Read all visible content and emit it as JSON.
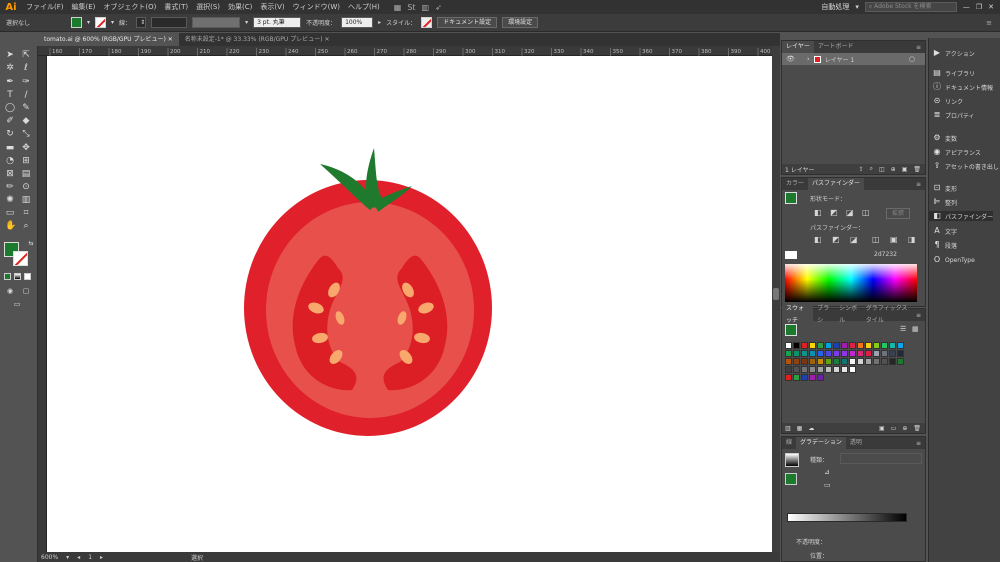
{
  "app": {
    "logo": "Ai"
  },
  "menubar": {
    "items": [
      "ファイル(F)",
      "編集(E)",
      "オブジェクト(O)",
      "書式(T)",
      "選択(S)",
      "効果(C)",
      "表示(V)",
      "ウィンドウ(W)",
      "ヘルプ(H)"
    ],
    "workspace": "自動処理",
    "search_placeholder": "Adobe Stock を検索"
  },
  "controlbar": {
    "selection_label": "選択なし",
    "stroke_label": "線：",
    "stroke_value": "3 pt. 丸筆",
    "opacity_label": "不透明度：",
    "opacity_value": "100%",
    "style_label": "スタイル：",
    "doc_settings": "ドキュメント設定",
    "preferences": "環境設定"
  },
  "doc_tabs": [
    {
      "label": "tomato.ai @ 600% (RGB/GPU プレビュー)",
      "active": true
    },
    {
      "label": "名称未設定-1* @ 33.33% (RGB/GPU プレビュー)",
      "active": false
    }
  ],
  "ruler": {
    "ticks": [
      "160",
      "170",
      "180",
      "190",
      "200",
      "210",
      "220",
      "230",
      "240",
      "250",
      "260",
      "270",
      "280",
      "290",
      "300",
      "310",
      "320",
      "330",
      "340",
      "350",
      "360",
      "370",
      "380",
      "390",
      "400"
    ]
  },
  "statusbar": {
    "zoom": "600%",
    "page": "1",
    "mode": "選択"
  },
  "layers_panel": {
    "tabs": [
      "レイヤー",
      "アートボード"
    ],
    "layer_name": "レイヤー 1",
    "count": "1 レイヤー"
  },
  "pathfinder_panel": {
    "tabs": [
      "カラー",
      "パスファインダー"
    ],
    "shape_modes_label": "形状モード：",
    "expand_button": "拡張",
    "pathfinders_label": "パスファインダー：",
    "hex_value": "2d7232"
  },
  "swatches_panel": {
    "tabs": [
      "スウォッチ",
      "ブラシ",
      "シンボル",
      "グラフィックスタイル"
    ]
  },
  "gradient_panel": {
    "tabs": [
      "線",
      "グラデーション",
      "透明"
    ],
    "type_label": "種類：",
    "opacity_label": "不透明度：",
    "position_label": "位置："
  },
  "dock": [
    {
      "label": "アクション",
      "icon": "play-icon"
    },
    {
      "label": "ライブラリ",
      "icon": "library-icon"
    },
    {
      "label": "ドキュメント情報",
      "icon": "info-icon"
    },
    {
      "label": "リンク",
      "icon": "link-icon"
    },
    {
      "label": "プロパティ",
      "icon": "properties-icon"
    },
    {
      "label": "変数",
      "icon": "variables-icon"
    },
    {
      "label": "アピアランス",
      "icon": "appearance-icon"
    },
    {
      "label": "アセットの書き出し",
      "icon": "export-icon"
    },
    {
      "label": "変形",
      "icon": "transform-icon"
    },
    {
      "label": "整列",
      "icon": "align-icon"
    },
    {
      "label": "パスファインダー",
      "icon": "pathfinder-icon"
    },
    {
      "label": "文字",
      "icon": "type-icon"
    },
    {
      "label": "段落",
      "icon": "paragraph-icon"
    },
    {
      "label": "OpenType",
      "icon": "opentype-icon"
    }
  ],
  "colors": {
    "fill": "#1c7a2c",
    "tomato_outer": "#e0202a",
    "tomato_inner": "#e8504c",
    "tomato_chamber": "#dc1f24",
    "seed": "#f8a86c",
    "stem": "#1f7a2e"
  }
}
